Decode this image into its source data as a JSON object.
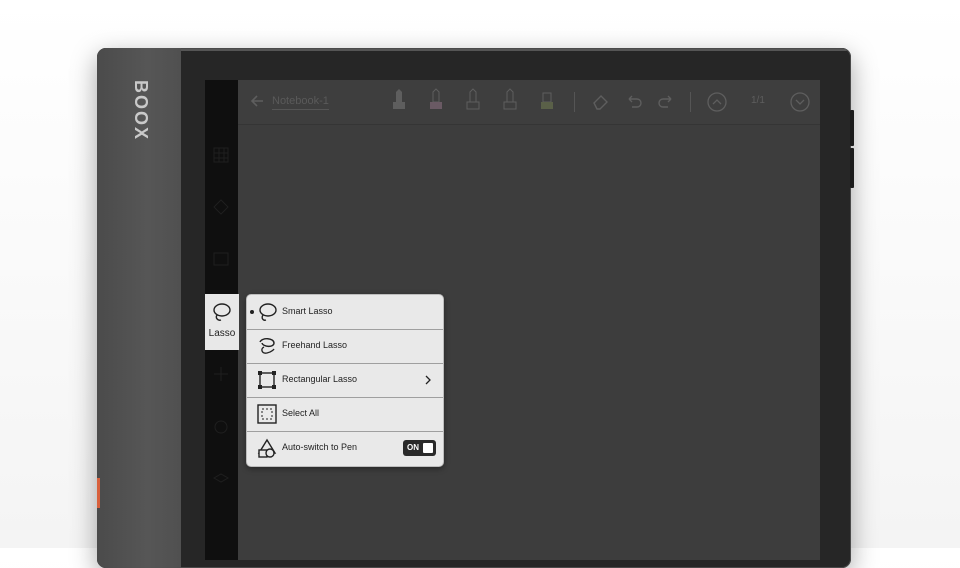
{
  "device": {
    "brand": "BOOX"
  },
  "toolbar": {
    "notebook_title": "Notebook-1",
    "page_number": "1/1",
    "icons": [
      "back-icon",
      "pen-icon",
      "pencil-icon",
      "marker-icon",
      "brush-icon",
      "highlighter-icon",
      "eraser-icon",
      "undo-icon",
      "redo-icon",
      "page-up-icon",
      "page-down-icon"
    ]
  },
  "side_rail": {
    "active_tool": "Lasso"
  },
  "lasso_menu": {
    "items": [
      {
        "label": "Smart Lasso",
        "icon": "smart-lasso-icon",
        "selected": true
      },
      {
        "label": "Freehand Lasso",
        "icon": "freehand-lasso-icon",
        "selected": false
      },
      {
        "label": "Rectangular Lasso",
        "icon": "rectangular-lasso-icon",
        "selected": false,
        "has_submenu": true
      },
      {
        "label": "Select All",
        "icon": "select-all-icon",
        "selected": false
      },
      {
        "label": "Auto-switch to Pen",
        "icon": "auto-switch-pen-icon",
        "selected": false,
        "toggle": "ON"
      }
    ]
  },
  "colors": {
    "accent": "#e85a3a",
    "device_body": "#262626",
    "screen": "#3c3c3c",
    "menu_bg": "#e9e9e9"
  }
}
